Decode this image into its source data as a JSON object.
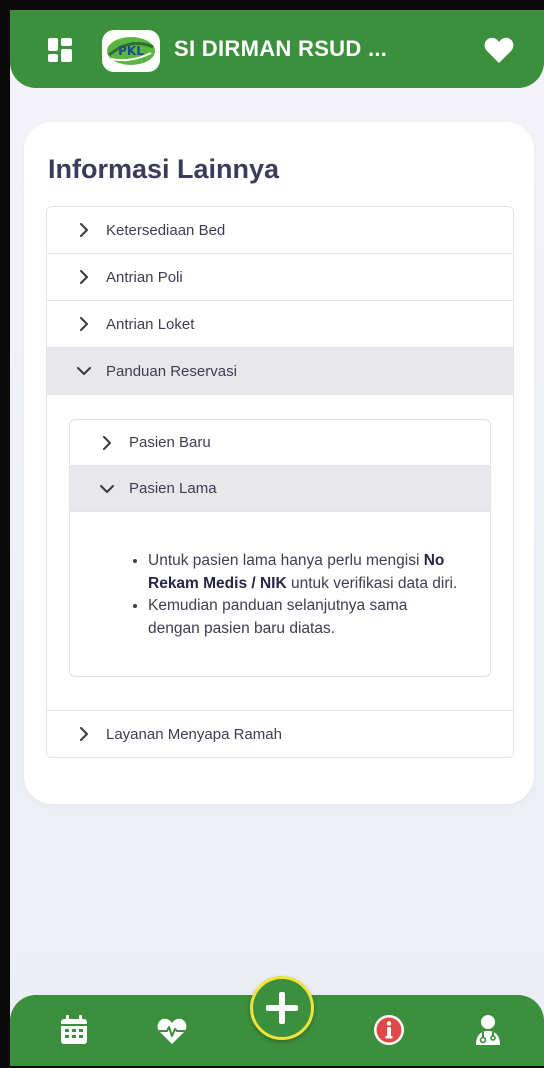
{
  "header": {
    "app_title": "SI DIRMAN RSUD ...",
    "menu_icon": "dashboard-grid-icon",
    "favorite_icon": "heart-icon",
    "logo_text": "PKL"
  },
  "page": {
    "title": "Informasi Lainnya"
  },
  "accordion": {
    "items": [
      {
        "label": "Ketersediaan Bed",
        "expanded": false
      },
      {
        "label": "Antrian Poli",
        "expanded": false
      },
      {
        "label": "Antrian Loket",
        "expanded": false
      },
      {
        "label": "Panduan Reservasi",
        "expanded": true
      },
      {
        "label": "Layanan Menyapa Ramah",
        "expanded": false
      }
    ],
    "reservasi": {
      "items": [
        {
          "label": "Pasien Baru",
          "expanded": false
        },
        {
          "label": "Pasien Lama",
          "expanded": true
        }
      ],
      "lama_content": {
        "bullet1_pre": "Untuk pasien lama hanya perlu mengisi",
        "bullet1_bold": "No Rekam Medis / NIK",
        "bullet1_post": "untuk verifikasi data diri.",
        "bullet2": "Kemudian panduan selanjutnya sama dengan pasien baru diatas."
      }
    }
  },
  "bottom_nav": {
    "items": [
      "calendar-icon",
      "heartbeat-icon",
      "add-icon",
      "info-icon",
      "doctor-icon"
    ],
    "colors": {
      "primary": "#3c8f3c",
      "fab_ring": "#f0e43a",
      "info": "#e04848"
    }
  }
}
